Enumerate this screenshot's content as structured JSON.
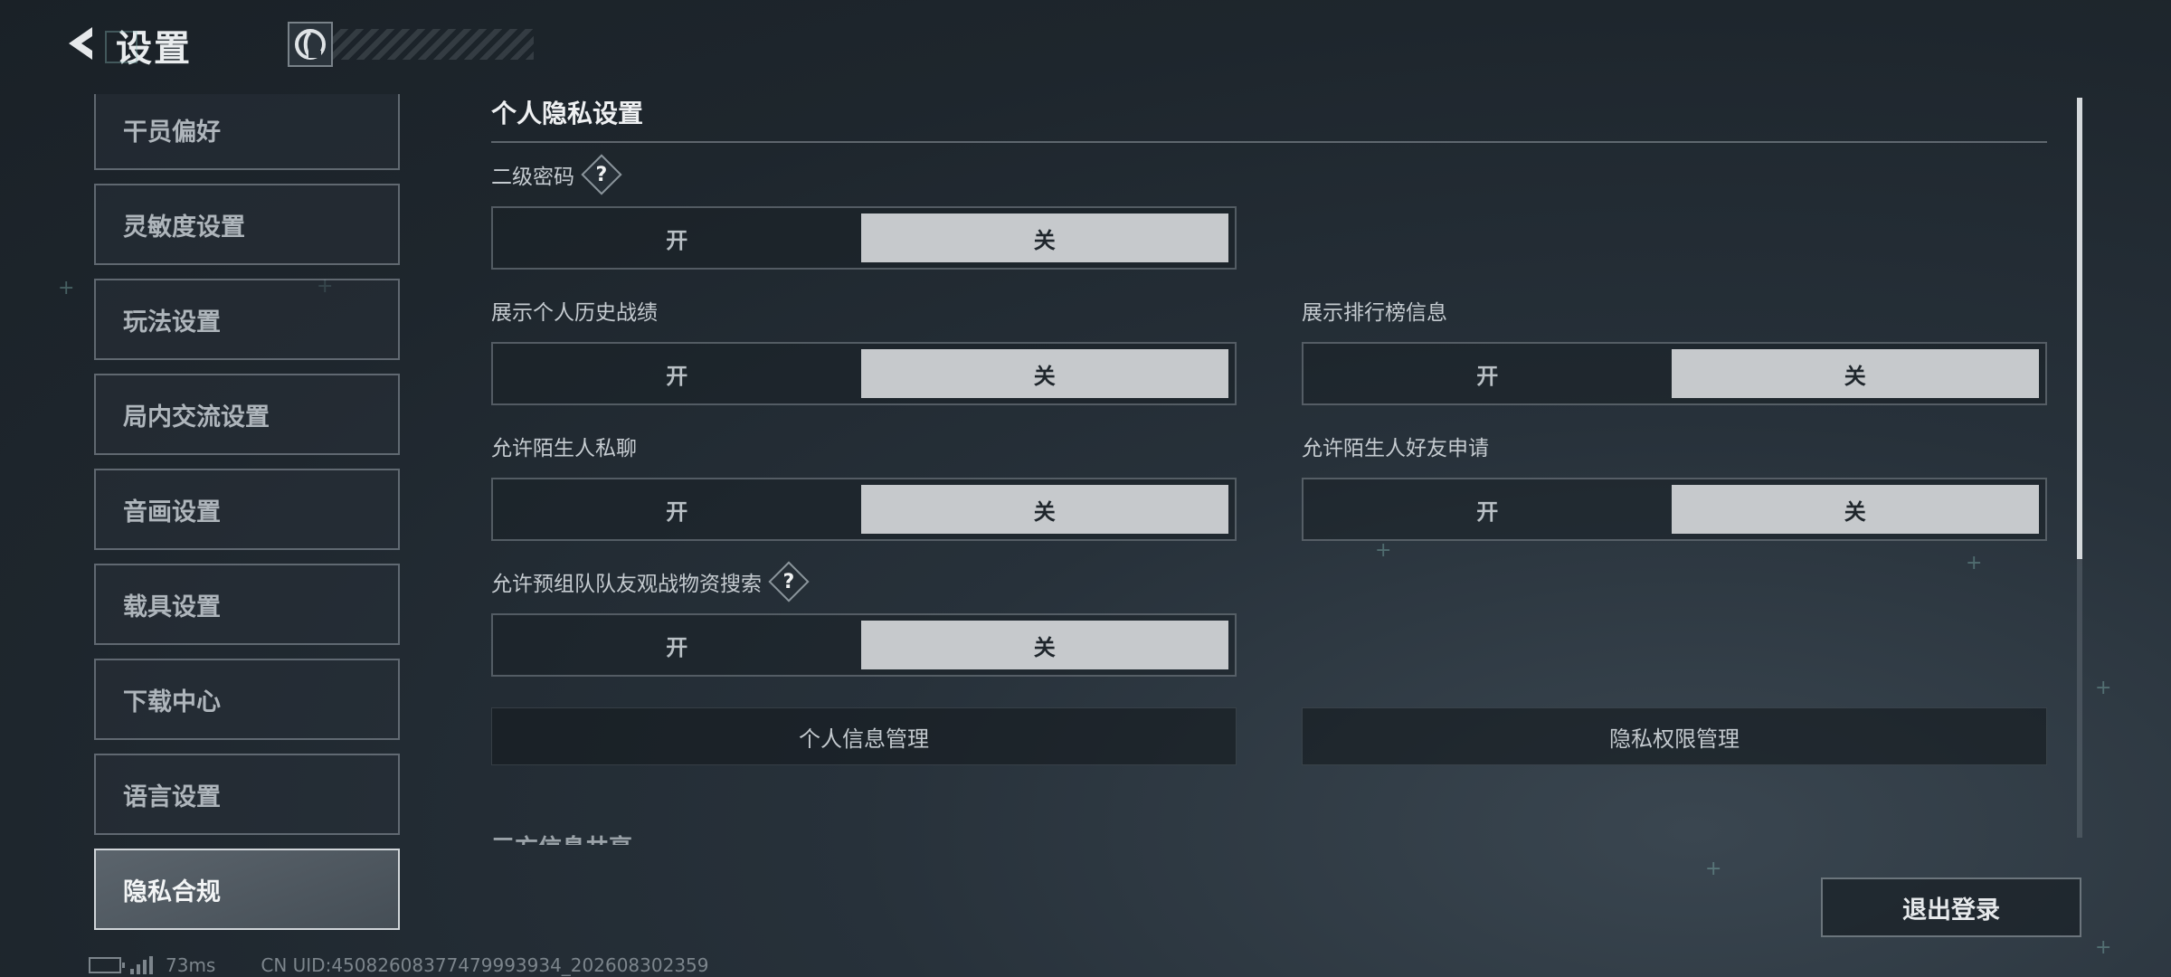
{
  "header": {
    "title": "设置"
  },
  "sidebar": {
    "items": [
      {
        "label": "干员偏好"
      },
      {
        "label": "灵敏度设置"
      },
      {
        "label": "玩法设置"
      },
      {
        "label": "局内交流设置"
      },
      {
        "label": "音画设置"
      },
      {
        "label": "载具设置"
      },
      {
        "label": "下载中心"
      },
      {
        "label": "语言设置"
      },
      {
        "label": "隐私合规",
        "active": true
      }
    ]
  },
  "privacy": {
    "section_title": "个人隐私设置",
    "settings": [
      {
        "label": "二级密码",
        "on": "开",
        "off": "关",
        "selected": "关"
      },
      {
        "label": "展示个人历史战绩",
        "on": "开",
        "off": "关",
        "selected": "关"
      },
      {
        "label": "展示排行榜信息",
        "on": "开",
        "off": "关",
        "selected": "关"
      },
      {
        "label": "允许陌生人私聊",
        "on": "开",
        "off": "关",
        "selected": "关"
      },
      {
        "label": "允许陌生人好友申请",
        "on": "开",
        "off": "关",
        "selected": "关"
      },
      {
        "label": "允许预组队队友观战物资搜索",
        "on": "开",
        "off": "关",
        "selected": "关"
      }
    ],
    "personal_info_button": "个人信息管理",
    "privacy_permission_button": "隐私权限管理",
    "next_section_partial": "三方信息共享"
  },
  "logout_button": "退出登录",
  "status": {
    "ping": "73ms",
    "uid": "CN UID:45082608377479993934_202608302359"
  },
  "colors": {
    "selected_toggle": "#c6c9cc",
    "background": "#1e262d"
  }
}
